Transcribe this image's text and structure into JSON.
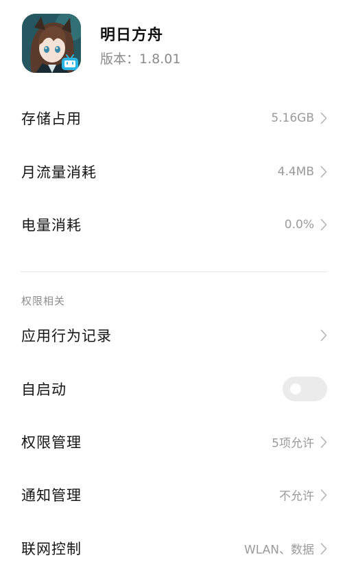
{
  "app": {
    "name": "明日方舟",
    "version": "版本：1.8.01",
    "icon": "arknights-app-icon",
    "badge_icon": "bilibili-tv-icon"
  },
  "usage": [
    {
      "label": "存储占用",
      "value": "5.16GB"
    },
    {
      "label": "月流量消耗",
      "value": "4.4MB"
    },
    {
      "label": "电量消耗",
      "value": "0.0%"
    }
  ],
  "permissions": {
    "section_title": "权限相关",
    "behavior_log": {
      "label": "应用行为记录"
    },
    "autostart": {
      "label": "自启动",
      "enabled": false
    },
    "permission_mgmt": {
      "label": "权限管理",
      "value": "5项允许"
    },
    "notification_mgmt": {
      "label": "通知管理",
      "value": "不允许"
    },
    "network_control": {
      "label": "联网控制",
      "value": "WLAN、数据"
    }
  },
  "colors": {
    "text_primary": "#151515",
    "text_secondary": "#9a9a9a",
    "toggle_off": "#ebebeb",
    "divider": "#e6e6e6",
    "badge": "#29b6e6"
  }
}
